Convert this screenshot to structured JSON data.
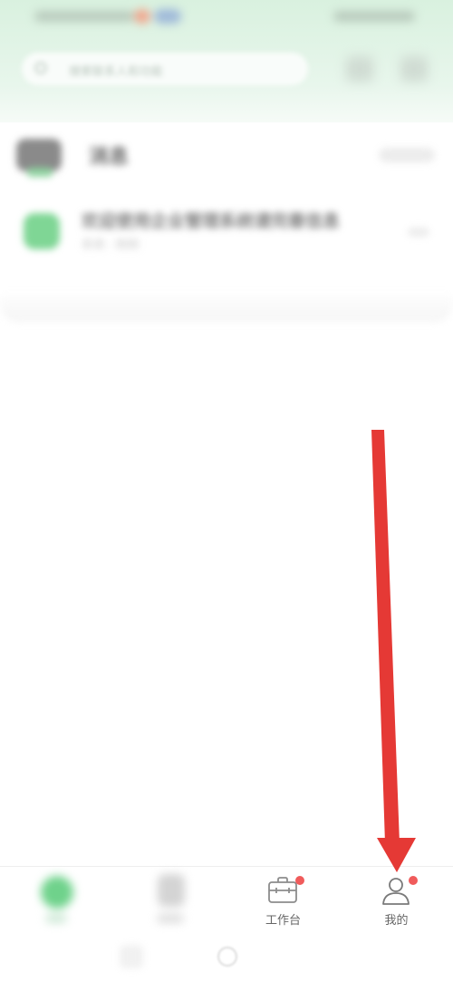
{
  "header": {
    "search_placeholder": "搜索联系人和功能"
  },
  "card": {
    "title": "消息",
    "message": {
      "title": "欢迎使用企业管理系统请完善信息",
      "subtitle": "系统 · 刚刚"
    }
  },
  "tab_bar": {
    "tabs": [
      {
        "label": "",
        "icon": "home-icon",
        "blurred": true
      },
      {
        "label": "",
        "icon": "message-icon",
        "blurred": true
      },
      {
        "label": "工作台",
        "icon": "briefcase-icon",
        "badge": true
      },
      {
        "label": "我的",
        "icon": "person-icon",
        "badge": true
      }
    ]
  },
  "colors": {
    "accent_green": "#6fd28b",
    "badge_red": "#f05b5b",
    "annotation_red": "#e53935"
  }
}
